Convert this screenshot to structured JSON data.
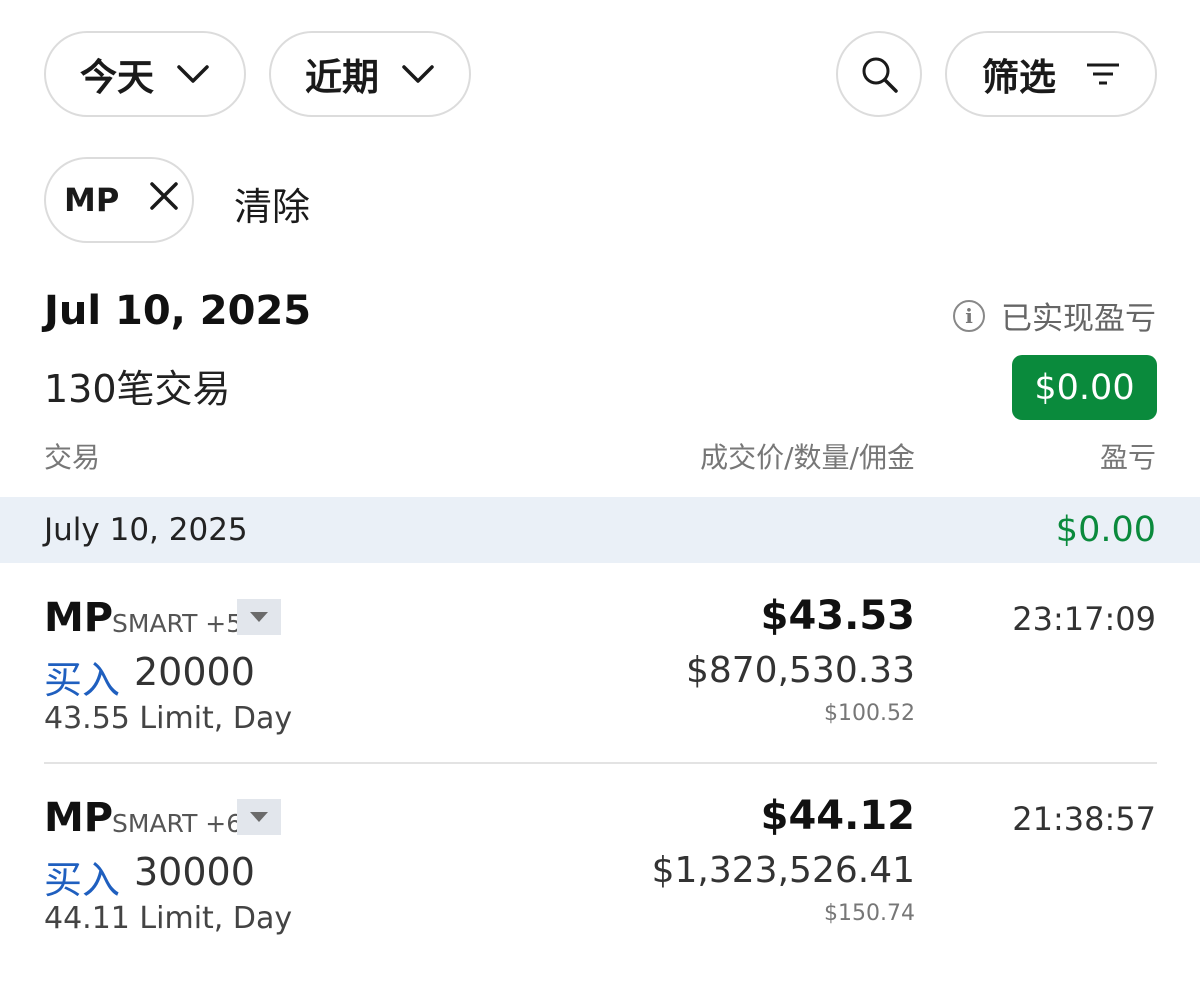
{
  "filters": {
    "today_label": "今天",
    "recent_label": "近期",
    "filter_label": "筛选"
  },
  "active_filter": {
    "chip_label": "MP",
    "clear_label": "清除"
  },
  "summary": {
    "date": "Jul 10, 2025",
    "trade_count": "130笔交易",
    "realized_label": "已实现盈亏",
    "realized_value": "$0.00"
  },
  "columns": {
    "trade": "交易",
    "price_qty_comm": "成交价/数量/佣金",
    "pnl": "盈亏"
  },
  "group": {
    "date": "July 10, 2025",
    "pnl": "$0.00"
  },
  "trades": [
    {
      "symbol": "MP",
      "exchange": "SMART +5",
      "side": "买入",
      "quantity": "20000",
      "order": "43.55 Limit, Day",
      "price": "$43.53",
      "amount": "$870,530.33",
      "commission": "$100.52",
      "time": "23:17:09"
    },
    {
      "symbol": "MP",
      "exchange": "SMART +6",
      "side": "买入",
      "quantity": "30000",
      "order": "44.11 Limit, Day",
      "price": "$44.12",
      "amount": "$1,323,526.41",
      "commission": "$150.74",
      "time": "21:38:57"
    }
  ],
  "colors": {
    "profit_green": "#0a8a3c",
    "buy_blue": "#1f5fbf",
    "band_bg": "#eaf0f7"
  },
  "icons": [
    "chevron-down-icon",
    "search-icon",
    "filter-lines-icon",
    "close-icon",
    "info-icon",
    "caret-down-icon"
  ]
}
